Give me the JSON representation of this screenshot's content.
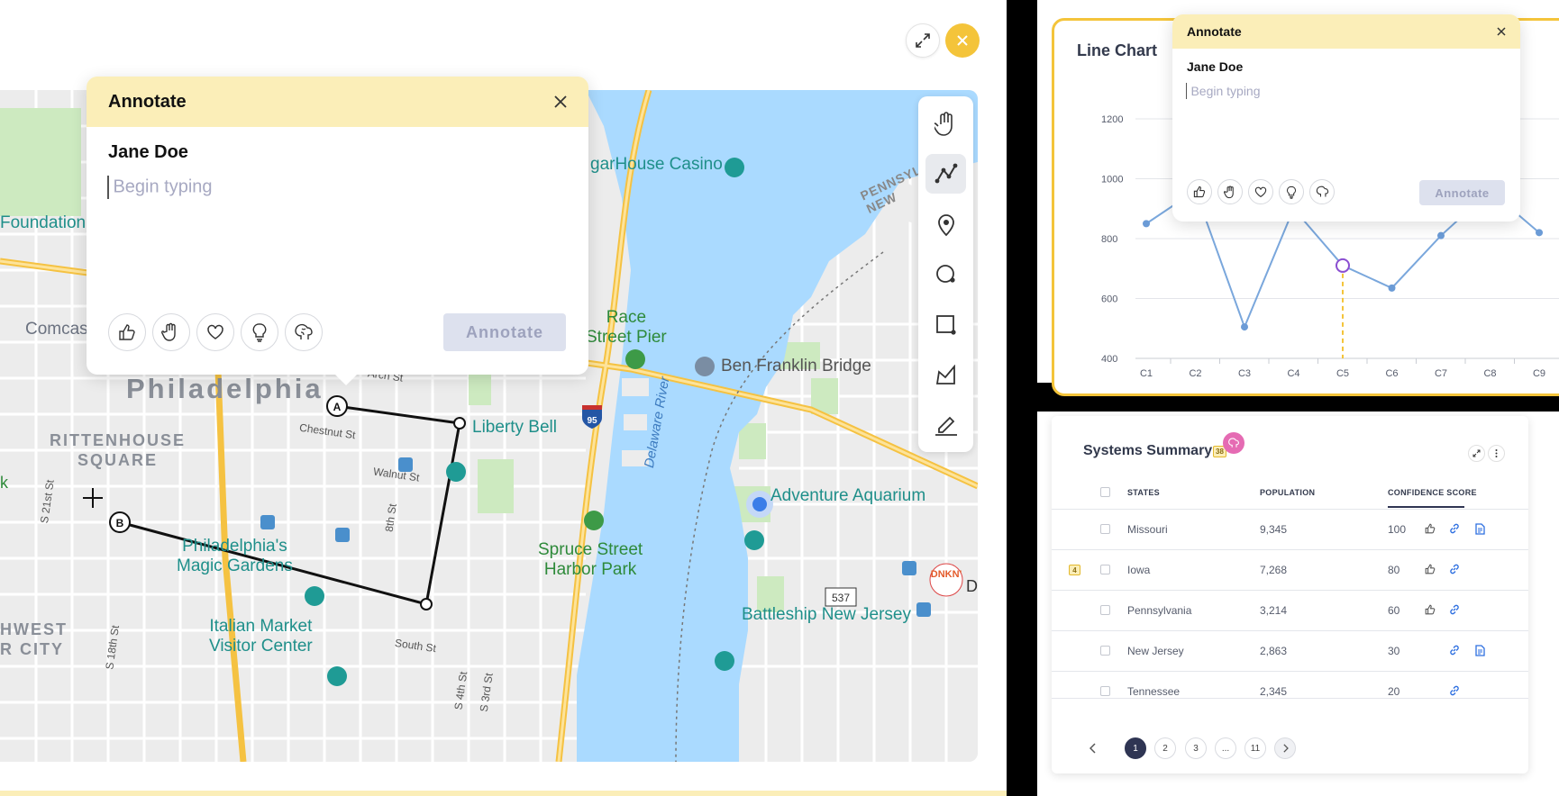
{
  "map_panel": {
    "expand_icon": "expand-icon",
    "close_icon": "close-icon",
    "annotate_popup": {
      "title": "Annotate",
      "user": "Jane Doe",
      "placeholder": "Begin typing",
      "submit_label": "Annotate",
      "reactions": [
        "thumbs-up-icon",
        "clap-icon",
        "heart-icon",
        "lightbulb-icon",
        "brain-icon"
      ]
    },
    "tools": [
      "hand-icon",
      "polyline-icon",
      "pin-icon",
      "circle-icon",
      "rectangle-icon",
      "polygon-icon",
      "pen-icon"
    ],
    "labels": {
      "casino": "garHouse Casino",
      "foundation": "Foundation",
      "comcast": "Comcas",
      "race_pier": "Race\nStreet Pier",
      "franklin_bridge": "Ben Franklin Bridge",
      "pennsylvania_nj": "PENNSYLV\nNEW",
      "philadelphia": "Philadelphia",
      "liberty_bell": "Liberty Bell",
      "rittenhouse": "RITTENHOUSE\nSQUARE",
      "chestnut": "Chestnut St",
      "walnut": "Walnut St",
      "arch": "Arch St",
      "eighth": "8th St",
      "s21": "S 21st St",
      "s18": "S 18th St",
      "south": "South St",
      "s4th": "S 4th St",
      "s3rd": "S 3rd St",
      "delaware": "Delaware River",
      "aquarium": "Adventure Aquarium",
      "magic_gardens": "Philadelphia's\nMagic Gardens",
      "spruce": "Spruce Street\nHarbor Park",
      "route_537": "537",
      "battleship": "Battleship New Jersey",
      "italian_market": "Italian Market\nVisitor Center",
      "hwest": "HWEST\nR CITY",
      "dunkin": "DNKN'",
      "d_letter": "D",
      "i95": "95",
      "k_letter": "k",
      "point_a": "A",
      "point_b": "B"
    }
  },
  "line_chart": {
    "title": "Line Chart",
    "popup": {
      "title": "Annotate",
      "user": "Jane Doe",
      "placeholder": "Begin typing",
      "submit_label": "Annotate"
    },
    "chart_data": {
      "type": "line",
      "title": "Line Chart",
      "categories": [
        "C1",
        "C2",
        "C3",
        "C4",
        "C5",
        "C6",
        "C7",
        "C8",
        "C9"
      ],
      "series": [
        {
          "values": [
            850,
            960,
            505,
            900,
            710,
            635,
            810,
            960,
            820
          ]
        }
      ],
      "yticks": [
        400,
        600,
        800,
        1000,
        1200
      ],
      "ylim": [
        400,
        1250
      ],
      "grid": true,
      "highlight_category": "C5"
    }
  },
  "summary": {
    "title": "Systems Summary",
    "badge_count": "38",
    "columns": [
      "STATES",
      "POPULATION",
      "CONFIDENCE SCORE"
    ],
    "rows": [
      {
        "state": "Missouri",
        "population": "9,345",
        "score": "100",
        "marker": ""
      },
      {
        "state": "Iowa",
        "population": "7,268",
        "score": "80",
        "marker": "4"
      },
      {
        "state": "Pennsylvania",
        "population": "3,214",
        "score": "60",
        "marker": ""
      },
      {
        "state": "New Jersey",
        "population": "2,863",
        "score": "30",
        "marker": ""
      },
      {
        "state": "Tennessee",
        "population": "2,345",
        "score": "20",
        "marker": ""
      }
    ],
    "pagination": [
      "1",
      "2",
      "3",
      "...",
      "11"
    ],
    "colors": {
      "accent": "#f4c43a",
      "navy": "#2f3553",
      "pink": "#e56bb3"
    }
  }
}
